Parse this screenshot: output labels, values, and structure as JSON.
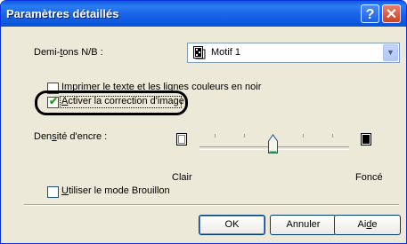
{
  "window": {
    "title": "Paramètres détaillés"
  },
  "titlebar": {
    "help_label": "?",
    "close_label": "✕"
  },
  "halftone": {
    "label_pre": "Demi-",
    "label_u": "t",
    "label_post": "ons N/B :",
    "selected": "Motif 1",
    "dropdown_glyph": "▼"
  },
  "print_black": {
    "label": "Imprimer le texte et les lignes couleurs en noir",
    "checked": false
  },
  "image_correction": {
    "label_u": "A",
    "label_post": "ctiver la correction d'image",
    "checked": true,
    "check_glyph": "✔"
  },
  "ink_density": {
    "label_pre": "Den",
    "label_u": "s",
    "label_post": "ité d'encre :",
    "min_label": "Clair",
    "max_label": "Foncé",
    "value_fraction": 0.5
  },
  "draft_mode": {
    "label_u": "U",
    "label_post": "tiliser le mode Brouillon",
    "checked": false
  },
  "buttons": {
    "ok": "OK",
    "cancel": "Annuler",
    "help_pre": "Ai",
    "help_u": "d",
    "help_post": "e"
  },
  "colors": {
    "titlebar": "#0a5ce6",
    "dialog_bg": "#ece9d8",
    "check": "#21a121"
  }
}
